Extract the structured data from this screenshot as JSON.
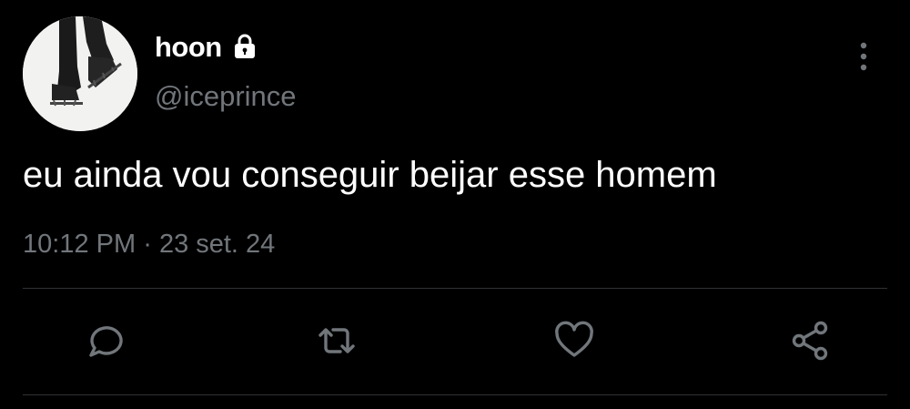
{
  "tweet": {
    "author": {
      "display_name": "hoon",
      "handle": "@iceprince",
      "protected_icon": "lock-icon",
      "avatar_icon": "ice-skates-avatar"
    },
    "text": "eu ainda vou conseguir beijar esse homem",
    "time": "10:12 PM",
    "separator": "·",
    "date": "23 set. 24"
  },
  "actions": {
    "reply_icon": "reply-icon",
    "retweet_icon": "retweet-icon",
    "like_icon": "heart-icon",
    "share_icon": "share-icon",
    "more_icon": "more-vertical-icon"
  },
  "colors": {
    "background": "#000000",
    "primary_text": "#ffffff",
    "secondary_text": "#71767b",
    "icon": "#71767b",
    "divider": "#2f3336"
  }
}
